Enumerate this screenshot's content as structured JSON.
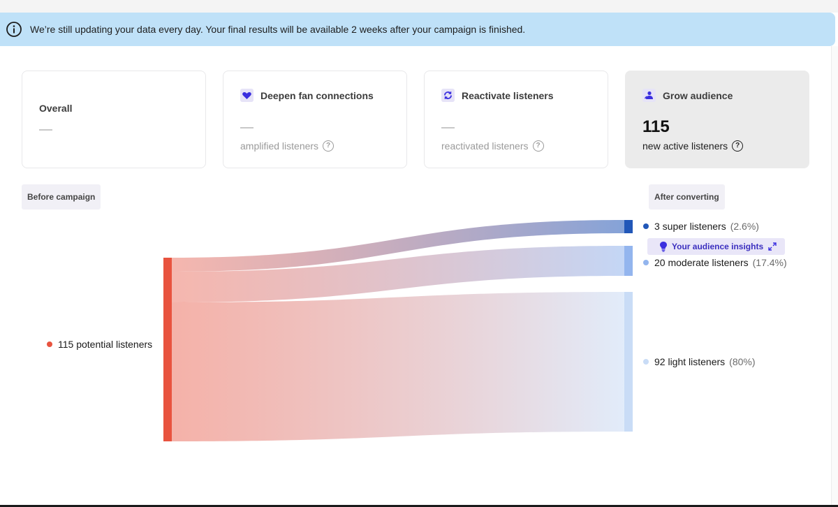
{
  "banner": {
    "text": "We’re still updating your data every day. Your final results will be available 2 weeks after your campaign is finished.",
    "icon": "info-icon"
  },
  "cards": {
    "overall": {
      "title": "Overall",
      "value": "—"
    },
    "deepen": {
      "title": "Deepen fan connections",
      "value": "—",
      "subtitle": "amplified listeners",
      "icon": "heart-icon"
    },
    "reactivate": {
      "title": "Reactivate listeners",
      "value": "—",
      "subtitle": "reactivated listeners",
      "icon": "refresh-icon"
    },
    "grow": {
      "title": "Grow audience",
      "value": "115",
      "subtitle": "new active listeners",
      "icon": "person-icon",
      "selected": true
    }
  },
  "stages": {
    "before": "Before campaign",
    "after": "After converting"
  },
  "sankey": {
    "source": {
      "label": "115 potential listeners",
      "color": "#e8533f"
    },
    "targets": [
      {
        "label": "3 super listeners",
        "pct": "(2.6%)",
        "color": "#2157b8"
      },
      {
        "label": "20 moderate listeners",
        "pct": "(17.4%)",
        "color": "#93b5ee"
      },
      {
        "label": "92 light listeners",
        "pct": "(80%)",
        "color": "#c9dcf6"
      }
    ]
  },
  "insights": {
    "label": "Your audience insights",
    "icon": "lightbulb-icon",
    "action_icon": "expand-icon"
  },
  "chart_data": {
    "type": "sankey",
    "nodes": [
      "115 potential listeners",
      "3 super listeners",
      "20 moderate listeners",
      "92 light listeners"
    ],
    "links": [
      {
        "source": "115 potential listeners",
        "target": "3 super listeners",
        "value": 3
      },
      {
        "source": "115 potential listeners",
        "target": "20 moderate listeners",
        "value": 20
      },
      {
        "source": "115 potential listeners",
        "target": "92 light listeners",
        "value": 92
      }
    ]
  },
  "colors": {
    "accent": "#3b2fbf",
    "banner_bg": "#bfe1f8",
    "source": "#e8533f"
  }
}
